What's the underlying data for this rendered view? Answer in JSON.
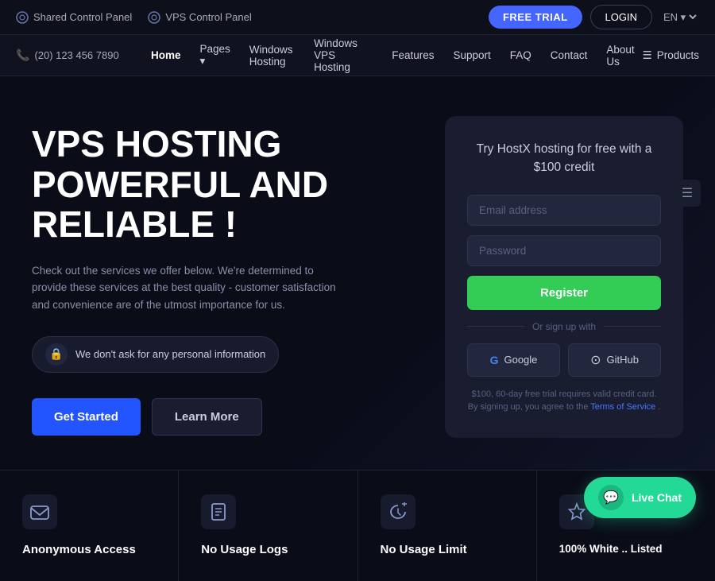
{
  "topBar": {
    "shared_panel_label": "Shared Control Panel",
    "vps_panel_label": "VPS Control Panel",
    "free_trial_label": "FREE TRIAL",
    "login_label": "LOGIN",
    "lang_label": "EN"
  },
  "navbar": {
    "phone": "(20) 123 456 7890",
    "links": [
      {
        "label": "Home",
        "active": true
      },
      {
        "label": "Pages",
        "dropdown": true
      },
      {
        "label": "Windows Hosting",
        "active": false
      },
      {
        "label": "Windows VPS Hosting",
        "active": false
      },
      {
        "label": "Features",
        "active": false
      },
      {
        "label": "Support",
        "active": false
      },
      {
        "label": "FAQ",
        "active": false
      },
      {
        "label": "Contact",
        "active": false
      },
      {
        "label": "About Us",
        "active": false
      }
    ],
    "products_label": "Products"
  },
  "hero": {
    "title_line1": "VPS HOSTING",
    "title_line2": "POWERFUL AND",
    "title_line3": "RELIABLE !",
    "description": "Check out the services we offer below. We're determined to provide these services at the best quality - customer satisfaction and convenience are of the utmost importance for us.",
    "badge_text": "We don't ask for any personal information",
    "btn_get_started": "Get Started",
    "btn_learn_more": "Learn More"
  },
  "formCard": {
    "title": "Try HostX hosting for free with a $100 credit",
    "email_placeholder": "Email address",
    "password_placeholder": "Password",
    "register_btn": "Register",
    "divider_text": "Or sign up with",
    "google_btn": "Google",
    "github_btn": "GitHub",
    "disclaimer": "$100, 60-day free trial requires valid credit card. By signing up, you agree to the",
    "tos_link": "Terms of Service",
    "tos_suffix": "."
  },
  "features": [
    {
      "icon": "✉",
      "title": "Anonymous Access",
      "subtitle": ""
    },
    {
      "icon": "⊡",
      "title": "No Usage Logs",
      "subtitle": ""
    },
    {
      "icon": "☁",
      "title": "No Usage Limit",
      "subtitle": ""
    },
    {
      "icon": "♡",
      "title": "100% White ..\nListed",
      "subtitle": ""
    }
  ],
  "liveChat": {
    "label": "Live Chat"
  }
}
